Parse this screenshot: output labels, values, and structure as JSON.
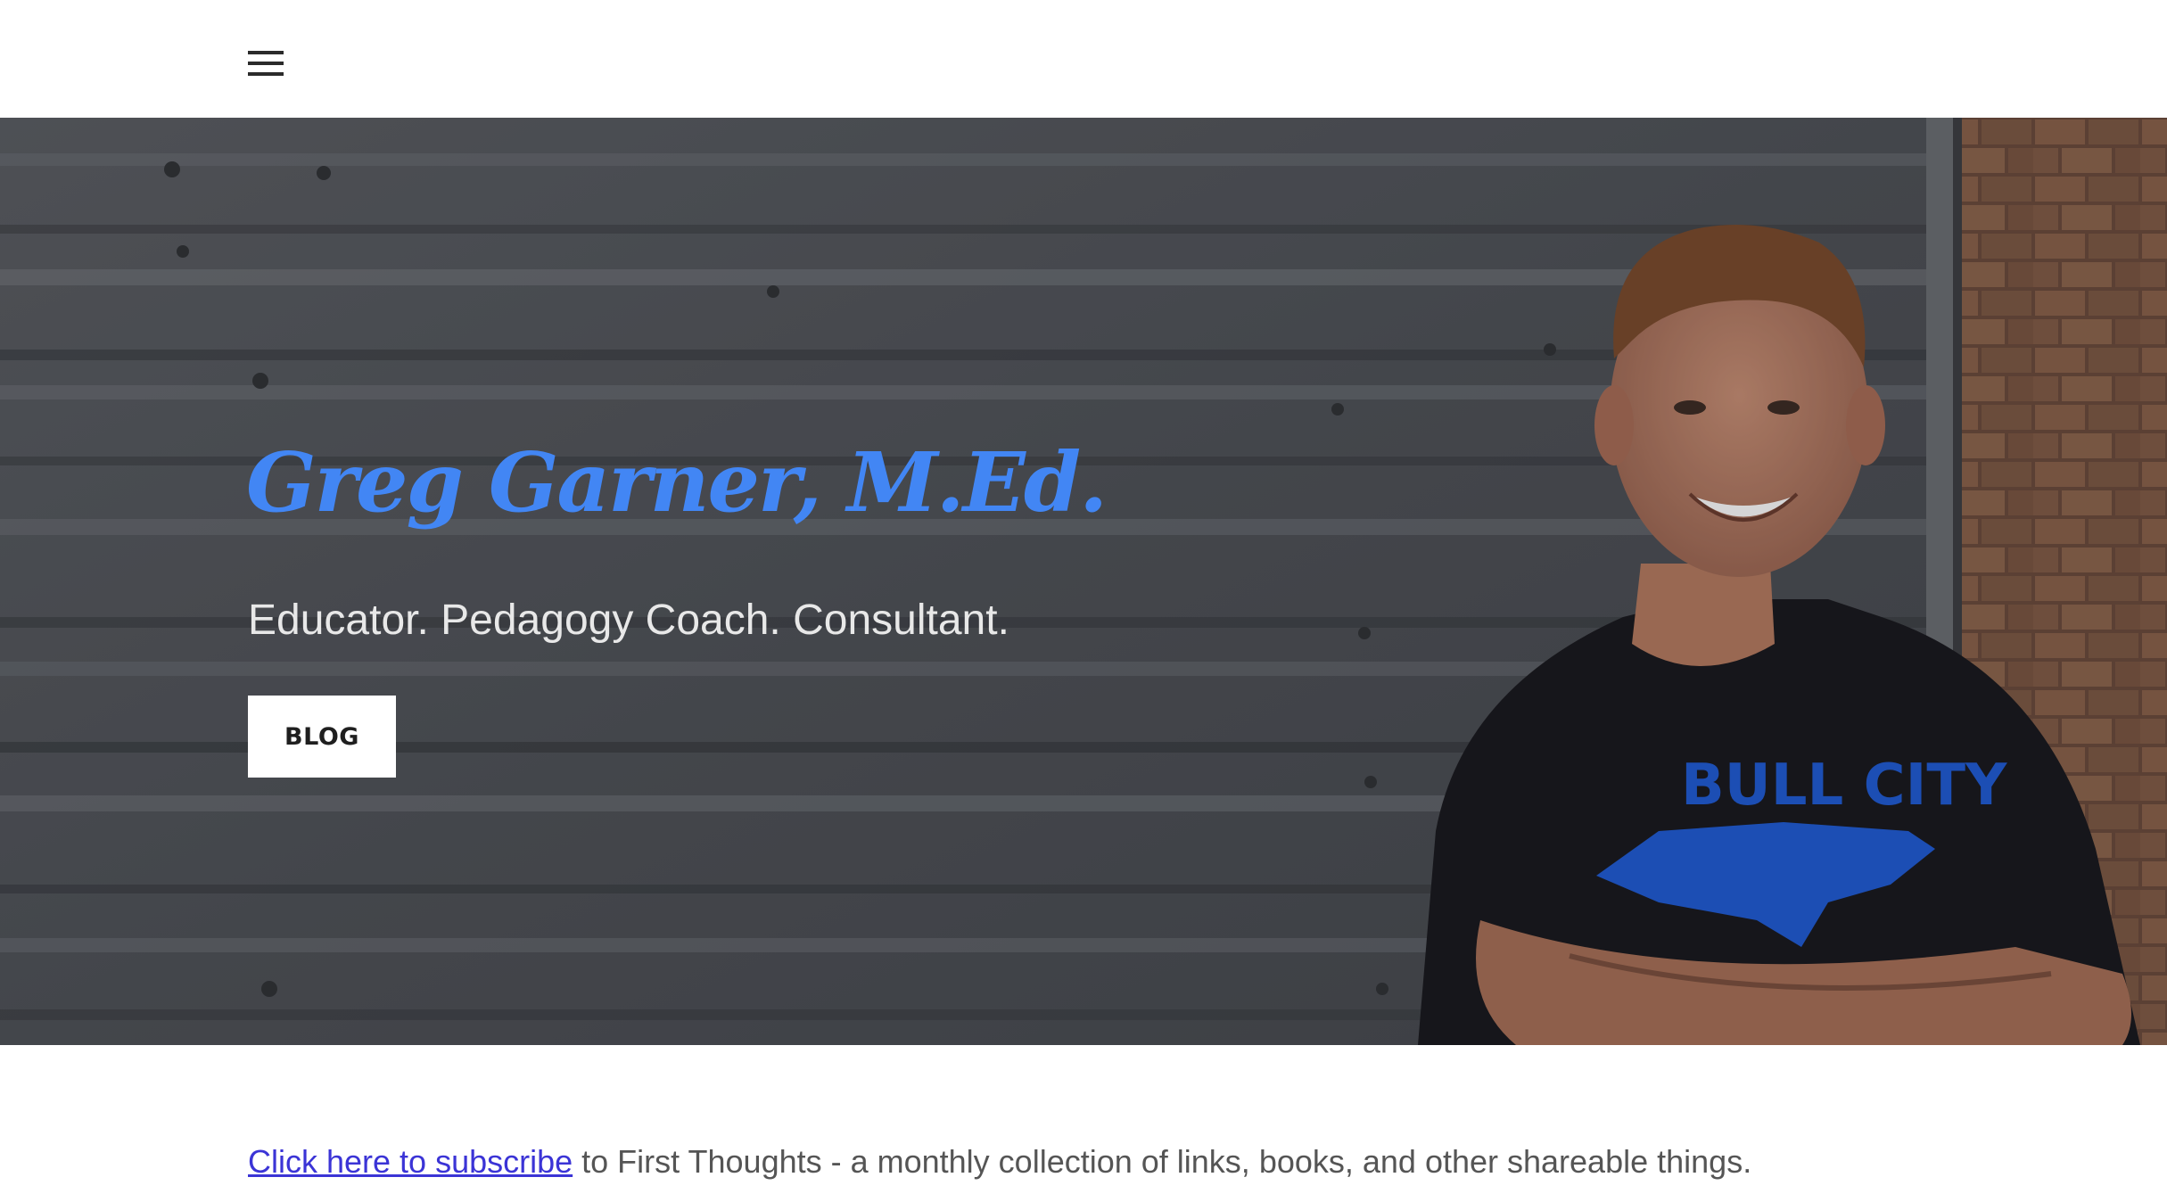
{
  "header": {
    "menu_icon": "hamburger-menu-icon"
  },
  "hero": {
    "title": "Greg Garner, M.Ed.",
    "subtitle": "Educator. Pedagogy Coach. Consultant.",
    "button_label": "BLOG",
    "title_color": "#4286f4",
    "shirt_text": "BULL CITY"
  },
  "subscribe": {
    "link_text": "Click here to subscribe",
    "rest_text": " to First Thoughts - a monthly collection of links, books, and other shareable things.",
    "link_color": "#3b34d6"
  }
}
